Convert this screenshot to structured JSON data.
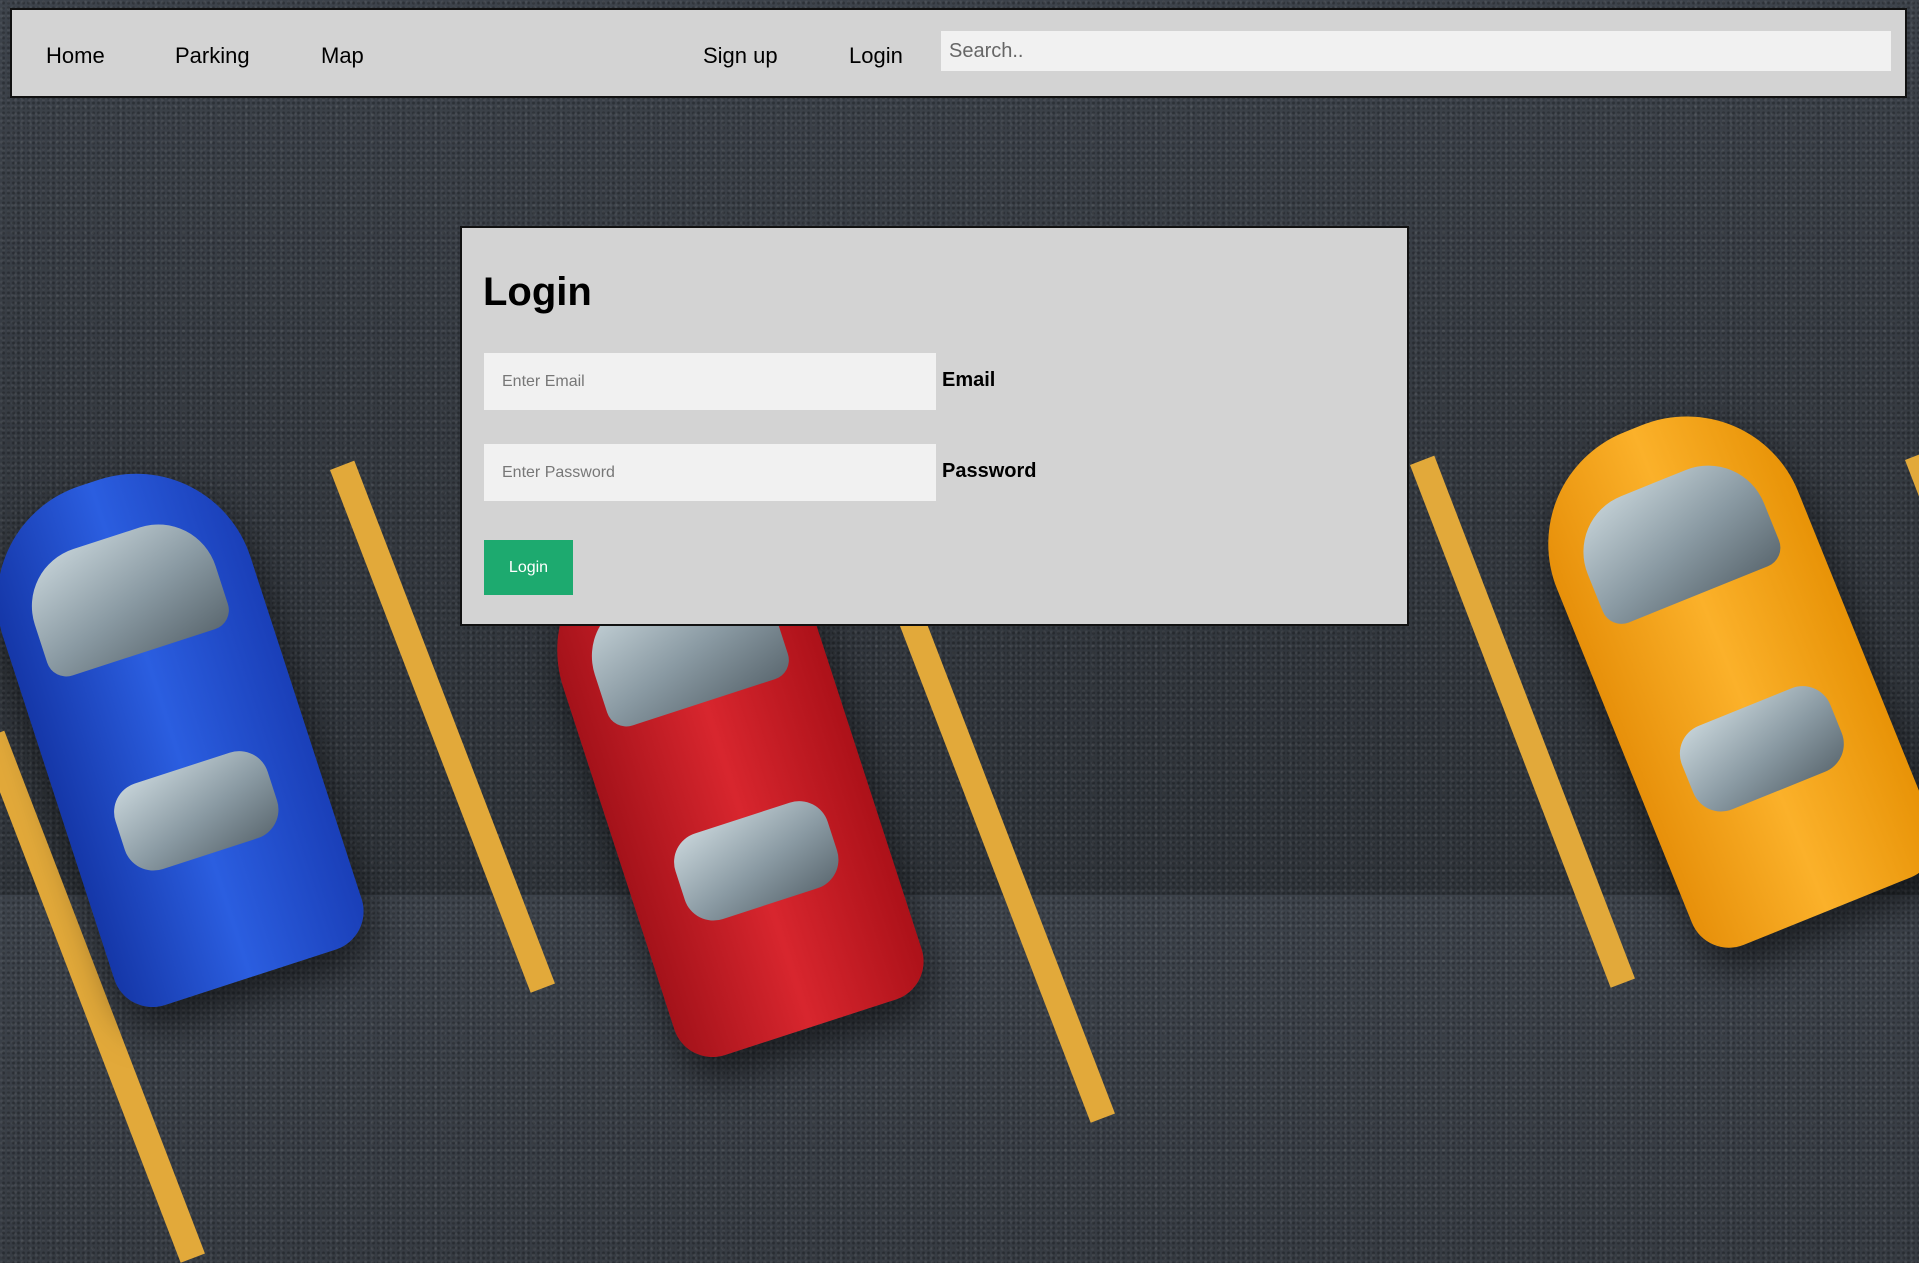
{
  "nav": {
    "home": "Home",
    "parking": "Parking",
    "map": "Map",
    "signup": "Sign up",
    "login": "Login",
    "search_placeholder": "Search.."
  },
  "login_form": {
    "title": "Login",
    "email_placeholder": "Enter Email",
    "email_label": "Email",
    "password_placeholder": "Enter Password",
    "password_label": "Password",
    "submit_label": "Login"
  },
  "colors": {
    "panel_bg": "#d3d3d3",
    "input_bg": "#f1f1f1",
    "button_bg": "#1daa6f",
    "stripe": "#e2a93a"
  }
}
